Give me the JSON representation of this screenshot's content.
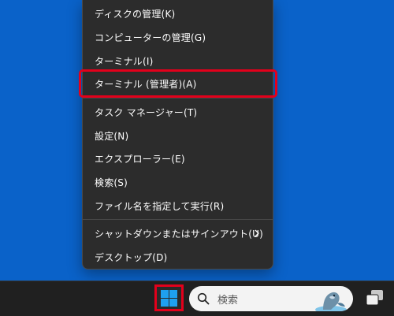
{
  "context_menu": {
    "items": [
      {
        "label": "ディスクの管理(K)"
      },
      {
        "label": "コンピューターの管理(G)"
      },
      {
        "label": "ターミナル(I)"
      },
      {
        "label": "ターミナル (管理者)(A)"
      },
      {
        "label": "タスク マネージャー(T)"
      },
      {
        "label": "設定(N)"
      },
      {
        "label": "エクスプローラー(E)"
      },
      {
        "label": "検索(S)"
      },
      {
        "label": "ファイル名を指定して実行(R)"
      },
      {
        "label": "シャットダウンまたはサインアウト(U)"
      },
      {
        "label": "デスクトップ(D)"
      }
    ]
  },
  "taskbar": {
    "search_placeholder": "検索",
    "start_icon": "windows-logo-icon",
    "search_icon": "search-icon",
    "task_view_icon": "task-view-icon"
  },
  "colors": {
    "desktop": "#0a62c9",
    "menu_bg": "#2c2c2c",
    "taskbar_bg": "#202020",
    "highlight_red": "#e3001b",
    "windows_blue": "#1ea0f0"
  }
}
